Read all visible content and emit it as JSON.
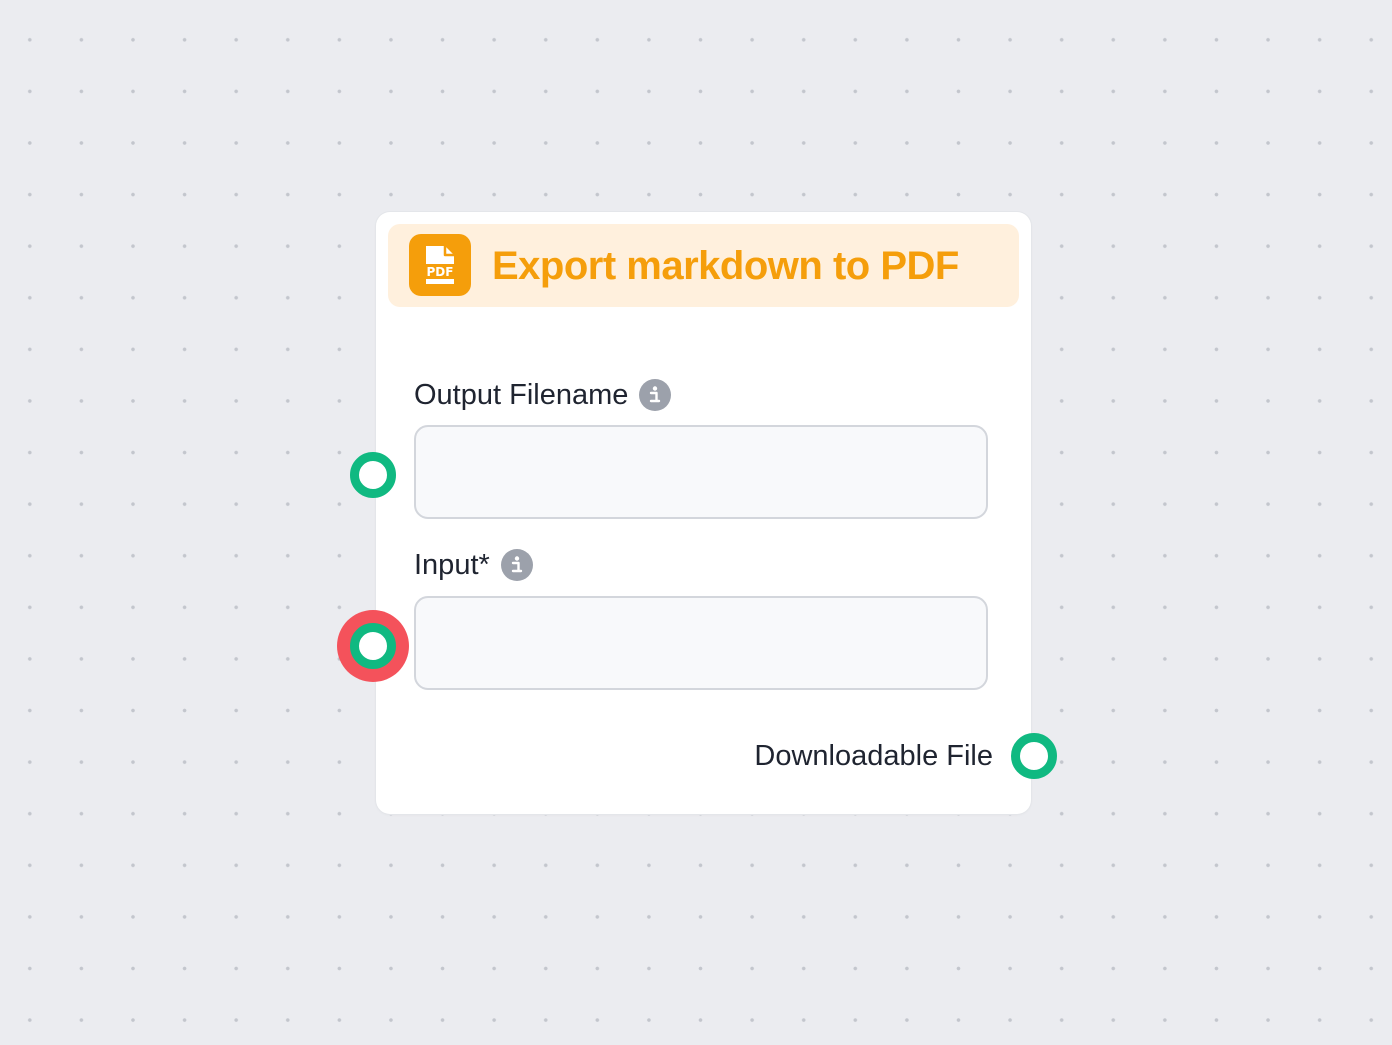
{
  "node": {
    "title": "Export markdown to PDF",
    "icon": "pdf-file-icon",
    "accent_color": "#f59e0b",
    "header_bg": "#fff0dd"
  },
  "fields": [
    {
      "label": "Output Filename",
      "required": false,
      "value": "",
      "placeholder": "",
      "info_icon": "info-icon"
    },
    {
      "label": "Input*",
      "required": true,
      "value": "",
      "placeholder": "",
      "info_icon": "info-icon",
      "handle_state": "error"
    }
  ],
  "output": {
    "label": "Downloadable File"
  },
  "colors": {
    "handle": "#10b981",
    "handle_error_ring": "#f4525b",
    "canvas_bg": "#ebecf0"
  }
}
